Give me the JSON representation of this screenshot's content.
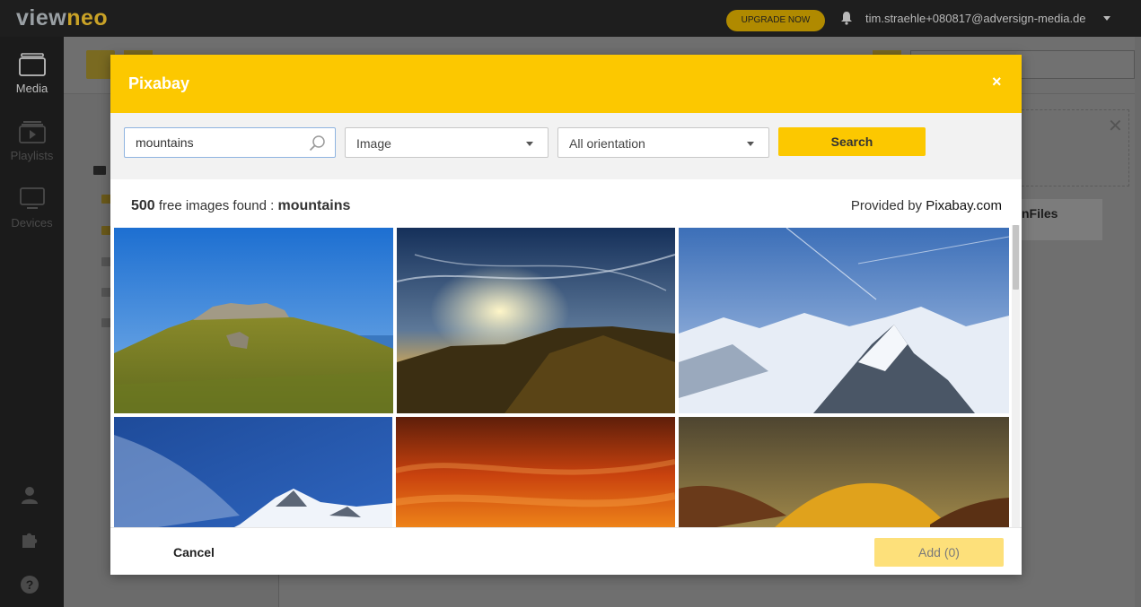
{
  "app": {
    "logo_part1": "view",
    "logo_part2": "neo",
    "upgrade_label": "UPGRADE NOW",
    "user_email": "tim.straehle+080817@adversign-media.de"
  },
  "sidebar": {
    "items": [
      {
        "label": "Media",
        "icon": "media-icon",
        "active": true
      },
      {
        "label": "Playlists",
        "icon": "playlists-icon",
        "active": false
      },
      {
        "label": "Devices",
        "icon": "devices-icon",
        "active": false
      }
    ],
    "bottom_icons": [
      "user-icon",
      "puzzle-icon",
      "help-icon"
    ]
  },
  "background": {
    "card_label": "nFiles"
  },
  "modal": {
    "title": "Pixabay",
    "close_label": "×",
    "search": {
      "value": "mountains",
      "placeholder": ""
    },
    "type_select": {
      "value": "Image"
    },
    "orientation_select": {
      "value": "All orientation"
    },
    "search_button": "Search",
    "results": {
      "count": "500",
      "text": "free images found :",
      "query": "mountains"
    },
    "provided_by": {
      "prefix": "Provided by",
      "source": "Pixabay.com"
    },
    "images": [
      {
        "desc": "green-hill-rocks"
      },
      {
        "desc": "sunset-clouds-ridge"
      },
      {
        "desc": "snowy-peaks"
      },
      {
        "desc": "snow-blue-sky"
      },
      {
        "desc": "orange-sky"
      },
      {
        "desc": "golden-hill"
      }
    ],
    "cancel_label": "Cancel",
    "add_label": "Add (0)"
  },
  "colors": {
    "accent": "#fcc800",
    "topbar": "#1e1e1e",
    "sidebar": "#1b1b1b"
  }
}
